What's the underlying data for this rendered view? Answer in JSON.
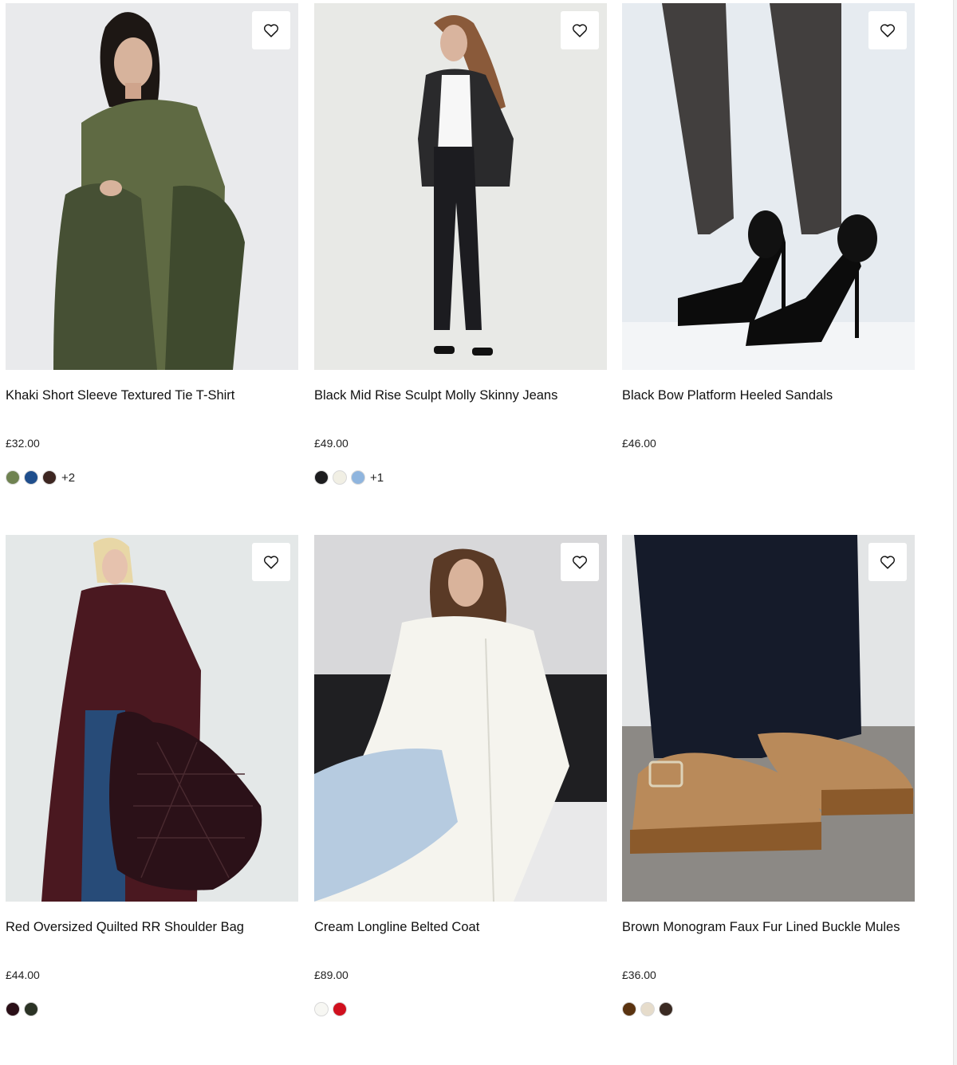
{
  "products": [
    {
      "name": "Khaki Short Sleeve Textured Tie T-Shirt",
      "price": "£32.00",
      "swatches": [
        "#6f8251",
        "#1f4e8c",
        "#3d2621"
      ],
      "more_colors": "+2"
    },
    {
      "name": "Black Mid Rise Sculpt Molly Skinny Jeans",
      "price": "£49.00",
      "swatches": [
        "#1c1c1e",
        "#f1efe4",
        "#8fb5de"
      ],
      "more_colors": "+1"
    },
    {
      "name": "Black Bow Platform Heeled Sandals",
      "price": "£46.00",
      "swatches": [],
      "more_colors": ""
    },
    {
      "name": "Red Oversized Quilted RR Shoulder Bag",
      "price": "£44.00",
      "swatches": [
        "#2a0f17",
        "#2b3325"
      ],
      "more_colors": ""
    },
    {
      "name": "Cream Longline Belted Coat",
      "price": "£89.00",
      "swatches": [
        "#f7f7f3",
        "#d0101e"
      ],
      "more_colors": ""
    },
    {
      "name": "Brown Monogram Faux Fur Lined Buckle Mules",
      "price": "£36.00",
      "swatches": [
        "#5a3310",
        "#e6dccb",
        "#3a2a22"
      ],
      "more_colors": ""
    }
  ],
  "icons": {
    "wishlist": "heart-outline-icon"
  }
}
